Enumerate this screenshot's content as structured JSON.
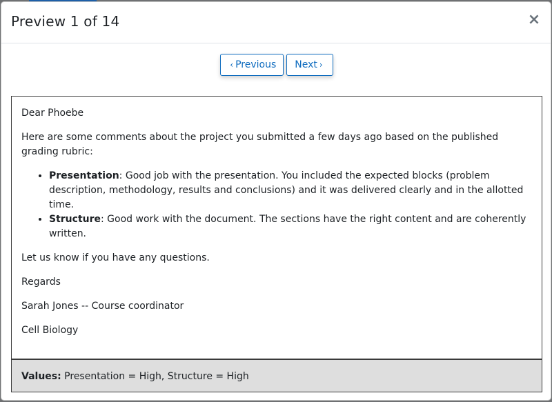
{
  "modal": {
    "title": "Preview 1 of 14",
    "close_glyph": "×"
  },
  "nav": {
    "previous_label": "Previous",
    "next_label": "Next",
    "chevron_left": "‹",
    "chevron_right": "›"
  },
  "letter": {
    "greeting": "Dear Phoebe",
    "intro": "Here are some comments about the project you submitted a few days ago based on the published grading rubric:",
    "items": [
      {
        "term": "Presentation",
        "text": ": Good job with the presentation. You included the expected blocks (problem description, methodology, results and conclusions) and it was delivered clearly and in the allotted time."
      },
      {
        "term": "Structure",
        "text": ": Good work with the document. The sections have the right content and are coherently written."
      }
    ],
    "questions": "Let us know if you have any questions.",
    "closing": "Regards",
    "signature": "Sarah Jones -- Course coordinator",
    "course": "Cell Biology"
  },
  "values": {
    "label": "Values:",
    "text": " Presentation = High, Structure = High"
  }
}
